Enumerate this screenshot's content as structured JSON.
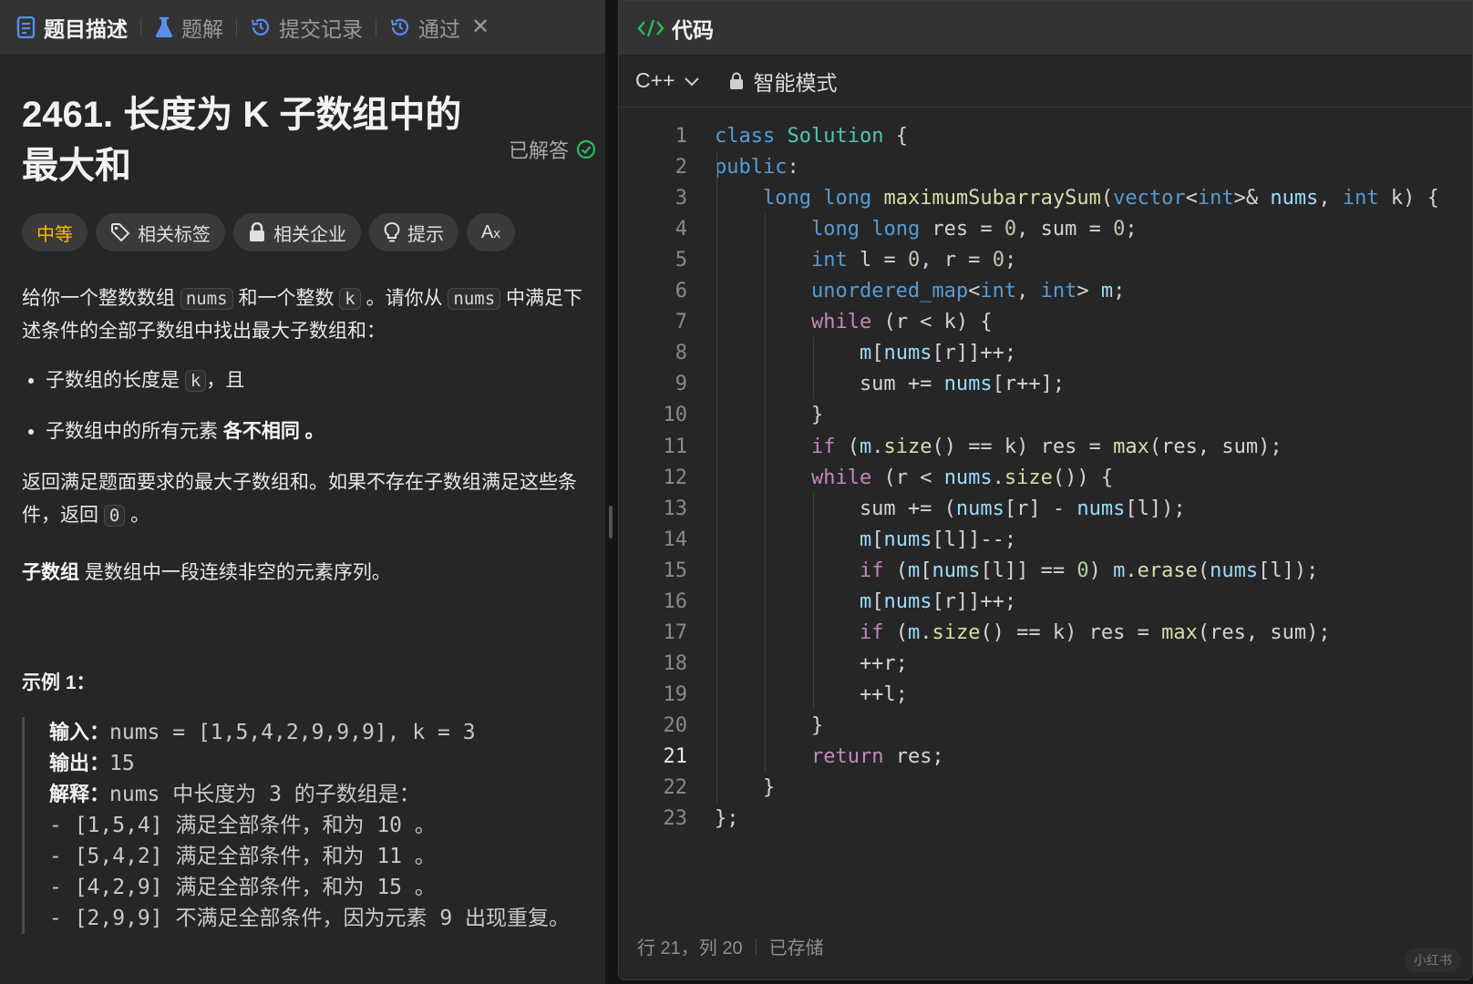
{
  "tabs": [
    {
      "label": "题目描述",
      "icon": "description-icon",
      "active": true
    },
    {
      "label": "题解",
      "icon": "flask-icon",
      "active": false
    },
    {
      "label": "提交记录",
      "icon": "history-icon",
      "active": false
    },
    {
      "label": "通过",
      "icon": "history-icon",
      "active": false
    }
  ],
  "problem": {
    "title": "2461. 长度为 K 子数组中的最大和",
    "solved_label": "已解答",
    "tags": [
      "中等",
      "相关标签",
      "相关企业",
      "提示",
      "A̅x"
    ],
    "desc": {
      "p1_a": "给你一个整数数组 ",
      "p1_nums": "nums",
      "p1_b": " 和一个整数 ",
      "p1_k": "k",
      "p1_c": " 。请你从 ",
      "p1_nums2": "nums",
      "p1_d": " 中满足下述条件的全部子数组中找出最大子数组和：",
      "cond1_a": "子数组的长度是 ",
      "cond1_k": "k",
      "cond1_b": "，且",
      "cond2_a": "子数组中的所有元素 ",
      "cond2_b": "各不相同 。",
      "p2_a": "返回满足题面要求的最大子数组和。如果不存在子数组满足这些条件，返回 ",
      "p2_zero": "0",
      "p2_b": " 。",
      "p3_bold": "子数组",
      "p3_rest": " 是数组中一段连续非空的元素序列。"
    },
    "example": {
      "heading": "示例 1：",
      "input_label": "输入：",
      "input_value": "nums = [1,5,4,2,9,9,9], k = 3",
      "output_label": "输出：",
      "output_value": "15",
      "explain_label": "解释：",
      "explain_value": "nums 中长度为 3 的子数组是：",
      "lines": [
        "- [1,5,4] 满足全部条件，和为 10 。",
        "- [5,4,2] 满足全部条件，和为 11 。",
        "- [4,2,9] 满足全部条件，和为 15 。",
        "- [2,9,9] 不满足全部条件，因为元素 9 出现重复。"
      ]
    }
  },
  "editor": {
    "header": "代码",
    "language": "C++",
    "mode": "智能模式",
    "current_line": 21,
    "lines": [
      "class Solution {",
      "public:",
      "    long long maximumSubarraySum(vector<int>& nums, int k) {",
      "        long long res = 0, sum = 0;",
      "        int l = 0, r = 0;",
      "        unordered_map<int, int> m;",
      "        while (r < k) {",
      "            m[nums[r]]++;",
      "            sum += nums[r++];",
      "        }",
      "        if (m.size() == k) res = max(res, sum);",
      "        while (r < nums.size()) {",
      "            sum += (nums[r] - nums[l]);",
      "            m[nums[l]]--;",
      "            if (m[nums[l]] == 0) m.erase(nums[l]);",
      "            m[nums[r]]++;",
      "            if (m.size() == k) res = max(res, sum);",
      "            ++r;",
      "            ++l;",
      "        }",
      "        return res;",
      "    }",
      "};"
    ],
    "status_position": "行 21，列 20",
    "status_saved": "已存储",
    "watermark": "小红书"
  },
  "colors": {
    "panel_bg": "#262626",
    "tab_bar_bg": "#333333",
    "difficulty_medium": "#ffb800",
    "keyword": "#569cd6",
    "control_keyword": "#c586c0",
    "class_name": "#4ec9b0",
    "function": "#dcdcaa",
    "number": "#b5cea8",
    "variable": "#9cdcfe"
  }
}
